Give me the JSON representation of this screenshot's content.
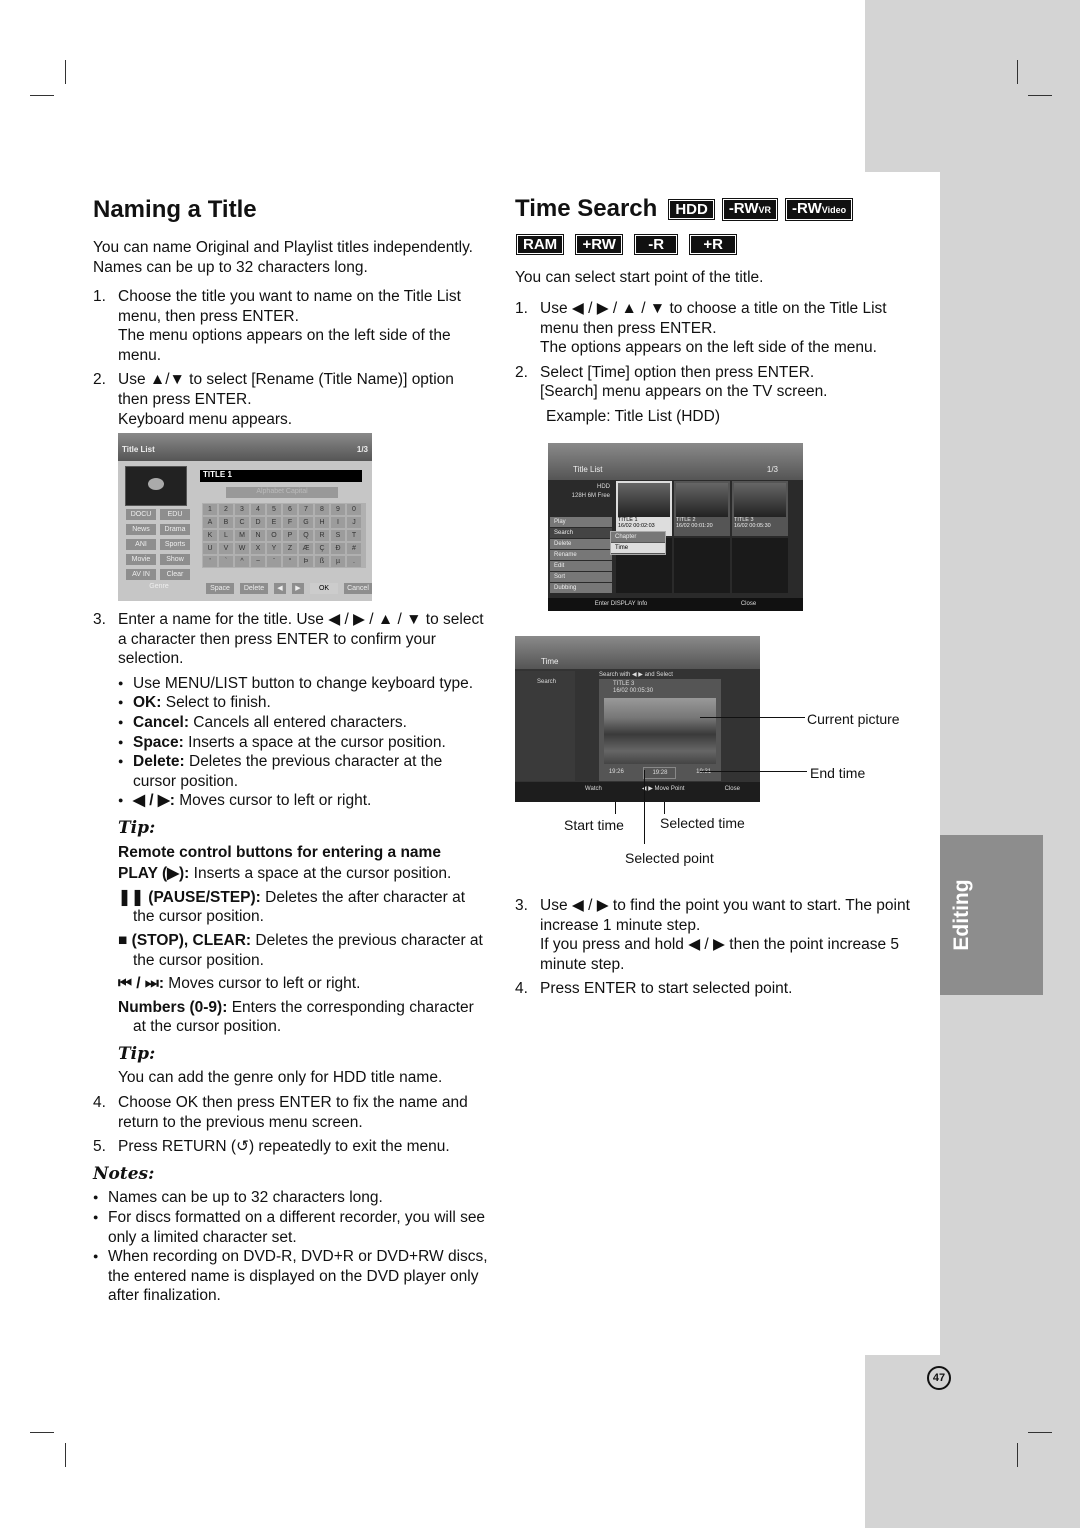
{
  "left": {
    "title": "Naming a Title",
    "intro": "You can name Original and Playlist titles independently. Names can be up to 32 characters long.",
    "steps": [
      {
        "n": "1.",
        "text": "Choose the title you want to name on the Title List menu, then press ENTER.",
        "sub": "The menu options appears on the left side of the menu."
      },
      {
        "n": "2.",
        "text": "Use ▲/▼ to select [Rename (Title Name)] option then press ENTER.",
        "sub": "Keyboard menu appears."
      },
      {
        "n": "3.",
        "text": "Enter a name for the title. Use ◀ / ▶ / ▲ / ▼ to select a character then press ENTER to confirm your selection."
      },
      {
        "n": "4.",
        "text": "Choose OK then press ENTER to fix the name and return to the previous menu screen."
      },
      {
        "n": "5.",
        "text": "Press RETURN (↺) repeatedly to exit the menu."
      }
    ],
    "bullets": [
      {
        "b": "",
        "t": "Use MENU/LIST button to change keyboard type."
      },
      {
        "b": "OK:",
        "t": " Select to finish."
      },
      {
        "b": "Cancel:",
        "t": " Cancels all entered characters."
      },
      {
        "b": "Space:",
        "t": " Inserts a space at the cursor position."
      },
      {
        "b": "Delete:",
        "t": " Deletes the previous character at the cursor position."
      },
      {
        "b": "◀ / ▶:",
        "t": " Moves cursor to left or right."
      }
    ],
    "tip1": {
      "label": "Tip:",
      "heading": "Remote control buttons for entering a name",
      "items": [
        {
          "b": "PLAY (▶):",
          "t": " Inserts a space at the cursor position."
        },
        {
          "b": "❚❚ (PAUSE/STEP):",
          "t": " Deletes the after character at the cursor position."
        },
        {
          "b": "■ (STOP), CLEAR:",
          "t": " Deletes the previous character at the cursor position."
        },
        {
          "b": "⏮ / ⏭:",
          "t": " Moves cursor to left or right."
        },
        {
          "b": "Numbers (0-9):",
          "t": " Enters the corresponding character at the cursor position."
        }
      ]
    },
    "tip2": {
      "label": "Tip:",
      "text": "You can add the genre only for HDD title name."
    },
    "notes": {
      "label": "Notes:",
      "items": [
        "Names can be up to 32 characters long.",
        "For discs formatted on a different recorder, you will see only a limited character set.",
        "When recording on DVD-R, DVD+R or DVD+RW discs, the entered name is displayed on the DVD player only after finalization."
      ]
    },
    "keyboard_screen": {
      "header": "Title List",
      "page": "1/3",
      "name": "TITLE 1",
      "mode": "Alphabet Capital",
      "genres": [
        "DOCU",
        "EDU",
        "News",
        "Drama",
        "ANI",
        "Sports",
        "Movie",
        "Show",
        "AV IN",
        "Clear"
      ],
      "genre_label": "Genre",
      "keys": [
        "1",
        "2",
        "3",
        "4",
        "5",
        "6",
        "7",
        "8",
        "9",
        "0",
        "A",
        "B",
        "C",
        "D",
        "E",
        "F",
        "G",
        "H",
        "I",
        "J",
        "K",
        "L",
        "M",
        "N",
        "O",
        "P",
        "Q",
        "R",
        "S",
        "T",
        "U",
        "V",
        "W",
        "X",
        "Y",
        "Z",
        "Æ",
        "Ç",
        "Ð",
        "#",
        "'",
        "`",
        "^",
        "~",
        "¨",
        "°",
        "Þ",
        "ß",
        "µ",
        "."
      ],
      "bottom": [
        "Space",
        "Delete",
        "◀",
        "▶",
        "OK",
        "Cancel"
      ]
    }
  },
  "right": {
    "title": "Time Search",
    "badges": [
      {
        "t": "HDD",
        "s": ""
      },
      {
        "t": "-RW",
        "s": "VR"
      },
      {
        "t": "-RW",
        "s": "Video"
      },
      {
        "t": "RAM",
        "s": ""
      },
      {
        "t": "+RW",
        "s": ""
      },
      {
        "t": "-R",
        "s": ""
      },
      {
        "t": "+R",
        "s": ""
      }
    ],
    "intro": "You can select start point of the title.",
    "steps": [
      {
        "n": "1.",
        "text": "Use ◀ / ▶ / ▲ / ▼ to choose a title on the Title List menu then press ENTER.",
        "sub": "The options appears on the left side of the menu."
      },
      {
        "n": "2.",
        "text": "Select [Time] option then press ENTER.",
        "sub": "[Search] menu appears on the TV screen."
      },
      {
        "n": "3.",
        "text": "Use ◀ / ▶ to find the point you want to start. The point increase 1 minute step.",
        "sub": "If you press and hold ◀ / ▶ then the point increase 5 minute step."
      },
      {
        "n": "4.",
        "text": "Press ENTER to start selected point."
      }
    ],
    "example": "Example: Title List (HDD)",
    "title_list_screen": {
      "header": "Title List",
      "page": "1/3",
      "disc": "HDD",
      "free": "128H 6M Free",
      "menu": [
        "Play",
        "Search",
        "Delete",
        "Rename",
        "Edit",
        "Sort",
        "Dubbing"
      ],
      "submenu": [
        "Chapter",
        "Time"
      ],
      "titles": [
        {
          "name": "TITLE 1",
          "date": "16/02",
          "dur": "00:02:03"
        },
        {
          "name": "TITLE 2",
          "date": "16/02",
          "dur": "00:01:20"
        },
        {
          "name": "TITLE 3",
          "date": "16/02",
          "dur": "00:05:30"
        }
      ],
      "footer_left": "Enter  DISPLAY Info",
      "footer_right": "Close"
    },
    "time_screen": {
      "header": "Time",
      "side": "Search",
      "instr": "Search with ◀ ▶ and Select",
      "title": "TITLE 3",
      "info": "16/02   00:05:30",
      "times": [
        "19:26",
        "19:28",
        "19:31"
      ],
      "footer": [
        "Watch",
        "◀ ▶ Move Point",
        "Close"
      ]
    },
    "callouts": {
      "current": "Current picture",
      "end": "End time",
      "start": "Start time",
      "selected_time": "Selected time",
      "selected_point": "Selected point"
    }
  },
  "side_tab": "Editing",
  "page_number": "47"
}
